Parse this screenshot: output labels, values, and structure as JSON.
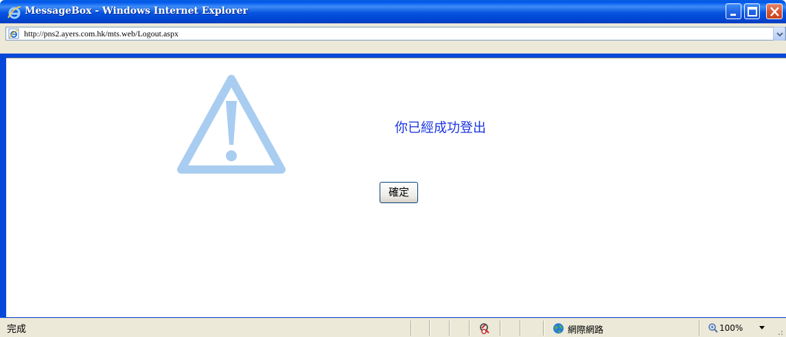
{
  "window": {
    "title": "MessageBox - Windows Internet Explorer",
    "icon": "ie-logo-icon",
    "controls": [
      "minimize-icon",
      "maximize-icon",
      "close-icon"
    ]
  },
  "address_bar": {
    "url": "http://pns2.ayers.com.hk/mts.web/Logout.aspx",
    "icon": "ie-page-icon",
    "dropdown_icon": "chevron-down-icon"
  },
  "content": {
    "icon": "warning-triangle-icon",
    "message": "你已經成功登出",
    "ok_button_label": "確定",
    "colors": {
      "message": "#1c35e0",
      "warning_icon": "#a9cdf0"
    }
  },
  "status_bar": {
    "status_text": "完成",
    "privacy_icon": "privacy-report-icon",
    "zone_icon": "globe-icon",
    "zone_label": "網際網路",
    "zoom_icon": "zoom-magnifier-icon",
    "zoom_label": "100%"
  }
}
